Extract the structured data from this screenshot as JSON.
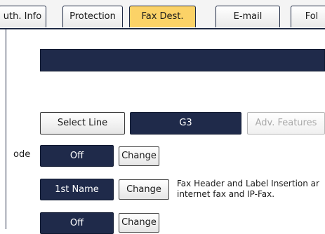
{
  "tabs": {
    "auth_info": "uth. Info",
    "protection": "Protection",
    "fax_dest": "Fax Dest.",
    "email": "E-mail",
    "folder": "Fol"
  },
  "line": {
    "select_line_label": "Select Line",
    "value": "G3",
    "adv_features_label": "Adv. Features"
  },
  "rows": {
    "mode_label": "ode",
    "mode_value": "Off",
    "mode_change": "Change",
    "name_value": "1st Name",
    "name_change": "Change",
    "note_line1": "Fax Header and Label Insertion ar",
    "note_line2": "internet fax and IP-Fax.",
    "third_value": "Off",
    "third_change": "Change"
  },
  "colors": {
    "accent_active_tab": "#fbd267",
    "dark_button": "#1f2a4a"
  }
}
